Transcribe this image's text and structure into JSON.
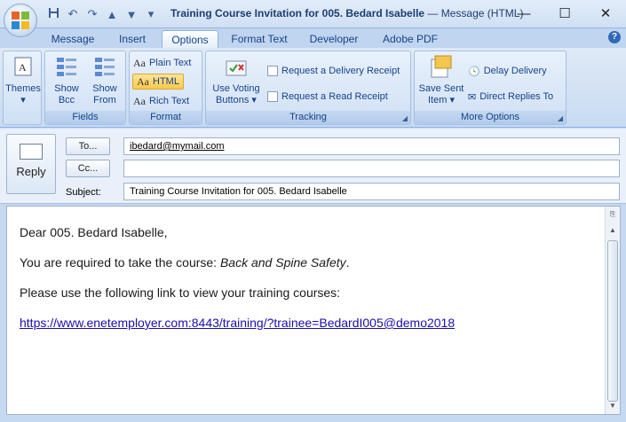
{
  "title": {
    "subject": "Training Course Invitation for 005. Bedard Isabelle",
    "suffix": "— Message (HTML)"
  },
  "quick_access": [
    "save-icon",
    "undo-icon",
    "redo-icon",
    "up-arrow-icon",
    "down-arrow-icon",
    "customize-icon"
  ],
  "tabs": [
    {
      "label": "Message"
    },
    {
      "label": "Insert"
    },
    {
      "label": "Options"
    },
    {
      "label": "Format Text"
    },
    {
      "label": "Developer"
    },
    {
      "label": "Adobe PDF"
    }
  ],
  "ribbon": {
    "themes": "Themes",
    "fields": {
      "show_bcc": "Show Bcc",
      "show_from": "Show From",
      "label": "Fields"
    },
    "format": {
      "plain_text": "Plain Text",
      "html": "HTML",
      "rich_text": "Rich Text",
      "label": "Format",
      "aa": "Aa"
    },
    "tracking": {
      "voting": "Use Voting Buttons",
      "delivery": "Request a Delivery Receipt",
      "read": "Request a Read Receipt",
      "label": "Tracking"
    },
    "more": {
      "save_sent": "Save Sent Item",
      "delay": "Delay Delivery",
      "direct": "Direct Replies To",
      "label": "More Options"
    }
  },
  "header": {
    "reply": "Reply",
    "to_label": "To...",
    "cc_label": "Cc...",
    "subject_label": "Subject:",
    "to_value": "ibedard@mymail.com",
    "cc_value": "",
    "subject_value": "Training Course Invitation for 005. Bedard Isabelle"
  },
  "body": {
    "greeting": "Dear 005. Bedard Isabelle,",
    "line1_prefix": "You are required to take the course: ",
    "course": "Back and Spine Safety",
    "line1_suffix": ".",
    "line2": "Please use the following link to view your training courses:",
    "link": "https://www.enetemployer.com:8443/training/?trainee=BedardI005@demo2018"
  },
  "colors": {
    "accent": "#15428b",
    "ribbon": "#c5d9f1",
    "active_format": "#ffc946"
  }
}
